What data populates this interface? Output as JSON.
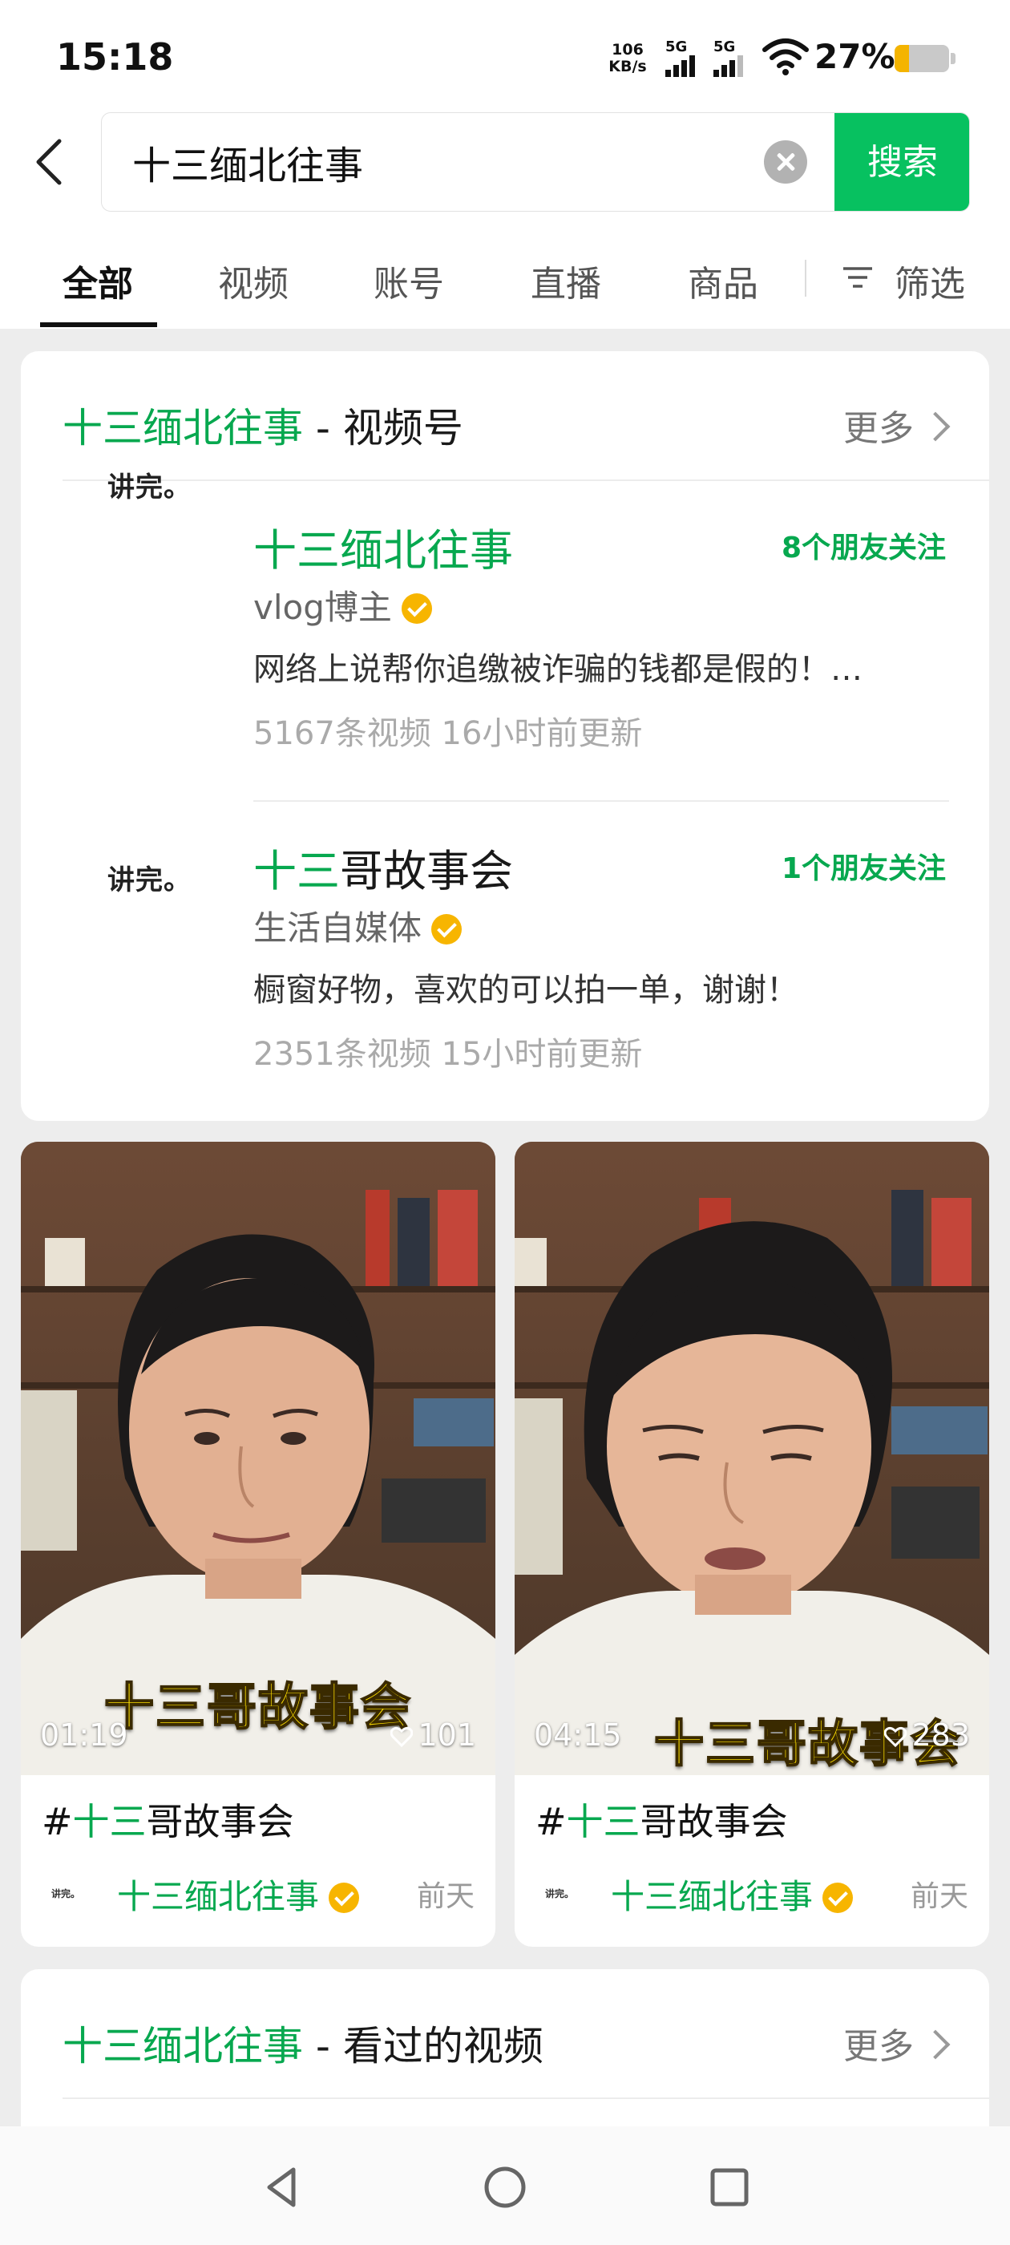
{
  "status_bar": {
    "time": "15:18",
    "net_speed_value": "106",
    "net_speed_unit": "KB/s",
    "sim1_label": "5G",
    "sim2_label": "5G",
    "battery_pct": "27%",
    "battery_level": 0.27
  },
  "search": {
    "query": "十三缅北往事",
    "button_label": "搜索",
    "back_icon": "chevron-left-icon",
    "clear_icon": "close-circle-icon"
  },
  "tabs": {
    "items": [
      "全部",
      "视频",
      "账号",
      "直播",
      "商品"
    ],
    "active_index": 0,
    "filter_label": "筛选",
    "filter_icon": "filter-icon"
  },
  "channel_section": {
    "title_highlight": "十三缅北往事",
    "title_rest": " - 视频号",
    "more_label": "更多",
    "accounts": [
      {
        "logo_text": "讲完。",
        "name_highlight": "十三缅北往事",
        "name_rest": "",
        "friends": "8个朋友关注",
        "type": "vlog博主",
        "desc": "网络上说帮你追缴被诈骗的钱都是假的！…",
        "meta": "5167条视频  16小时前更新"
      },
      {
        "logo_text": "讲完。",
        "name_highlight": "十三",
        "name_rest": "哥故事会",
        "friends": "1个朋友关注",
        "type": "生活自媒体",
        "desc": "橱窗好物，喜欢的可以拍一单，谢谢！",
        "meta": "2351条视频  15小时前更新"
      }
    ]
  },
  "videos": [
    {
      "duration": "01:19",
      "likes": "101",
      "caption": "十三哥故事会",
      "title_prefix": "#",
      "title_highlight": "十三",
      "title_rest": "哥故事会",
      "author_avatar": "讲完。",
      "author": "十三缅北往事",
      "date": "前天"
    },
    {
      "duration": "04:15",
      "likes": "283",
      "caption": "十三哥故事会",
      "title_prefix": "#",
      "title_highlight": "十三",
      "title_rest": "哥故事会",
      "author_avatar": "讲完。",
      "author": "十三缅北往事",
      "date": "前天"
    }
  ],
  "watched_section": {
    "title_highlight": "十三缅北往事",
    "title_rest": " - 看过的视频",
    "more_label": "更多"
  },
  "nav_bar": {
    "icons": [
      "nav-back-icon",
      "nav-home-icon",
      "nav-recents-icon"
    ]
  },
  "colors": {
    "accent_green": "#07c160",
    "highlight_green": "#07a84f",
    "verified_badge": "#f7b500",
    "battery": "#f4b400"
  }
}
